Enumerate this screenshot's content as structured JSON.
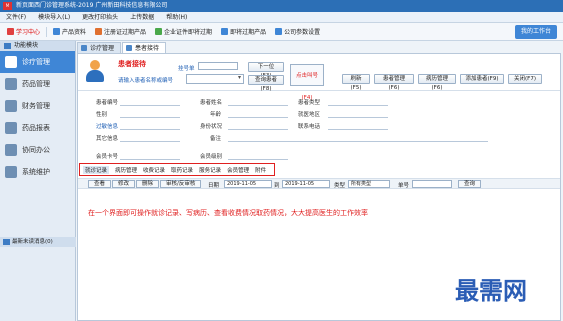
{
  "window": {
    "title": "新页面西门诊管理系统-2019  广州新田科技信息有限公司"
  },
  "menu": [
    "文件(F)",
    "模块导入(L)",
    "更改打印抬头",
    "上传数据",
    "帮助(H)"
  ],
  "toolbar": {
    "items": [
      "学习中心",
      "产品资料",
      "注册证过期产品",
      "企业证件即将过期",
      "即将过期产品",
      "公司参数设置"
    ],
    "right_button": "我的工作台"
  },
  "sidebar": {
    "header": "功能模块",
    "items": [
      "诊疗管理",
      "药品管理",
      "财务管理",
      "药品报表",
      "协同办公",
      "系统维护"
    ],
    "active": "诊疗管理",
    "footer": "最新未读消息(0)"
  },
  "tabs": [
    "诊疗管理",
    "患者接待"
  ],
  "patient": {
    "title": "患者接待",
    "code_label": "挂号单",
    "hint": "请输入患者名称或编号",
    "next_btn": "下一位(F3)",
    "query_btn": "查询患者(F8)",
    "call_text": "点击叫号(F4)",
    "action_buttons": [
      "刷新(F5)",
      "患者管理(F6)",
      "病历管理(F6)",
      "添加患者(F9)",
      "关闭(F7)"
    ]
  },
  "info": {
    "labels": [
      "患者编号",
      "性别",
      "过敏信息",
      "其它信息",
      "会员卡号",
      "患者姓名",
      "年龄",
      "身份状况",
      "备注",
      "会员级别",
      "患者类型",
      "就医地区",
      "联系电话"
    ]
  },
  "subtabs": [
    "就诊记录",
    "病历管理",
    "收费记录",
    "取药记录",
    "服务记录",
    "会员管理",
    "附件"
  ],
  "filter": {
    "buttons": [
      "查看",
      "修改",
      "删除",
      "审核/反审核"
    ],
    "date_label": "日期",
    "date_from": "2019-11-05",
    "date_to": "2019-11-05",
    "to_label": "到",
    "type_label": "类型",
    "type_value": "所有类型",
    "number_label": "单号",
    "query_label": "查询"
  },
  "content_message": "在一个界面即可操作就诊记录、写病历、查看收费情况取药情况，大大提高医生的工作效率",
  "watermark": "最需网"
}
